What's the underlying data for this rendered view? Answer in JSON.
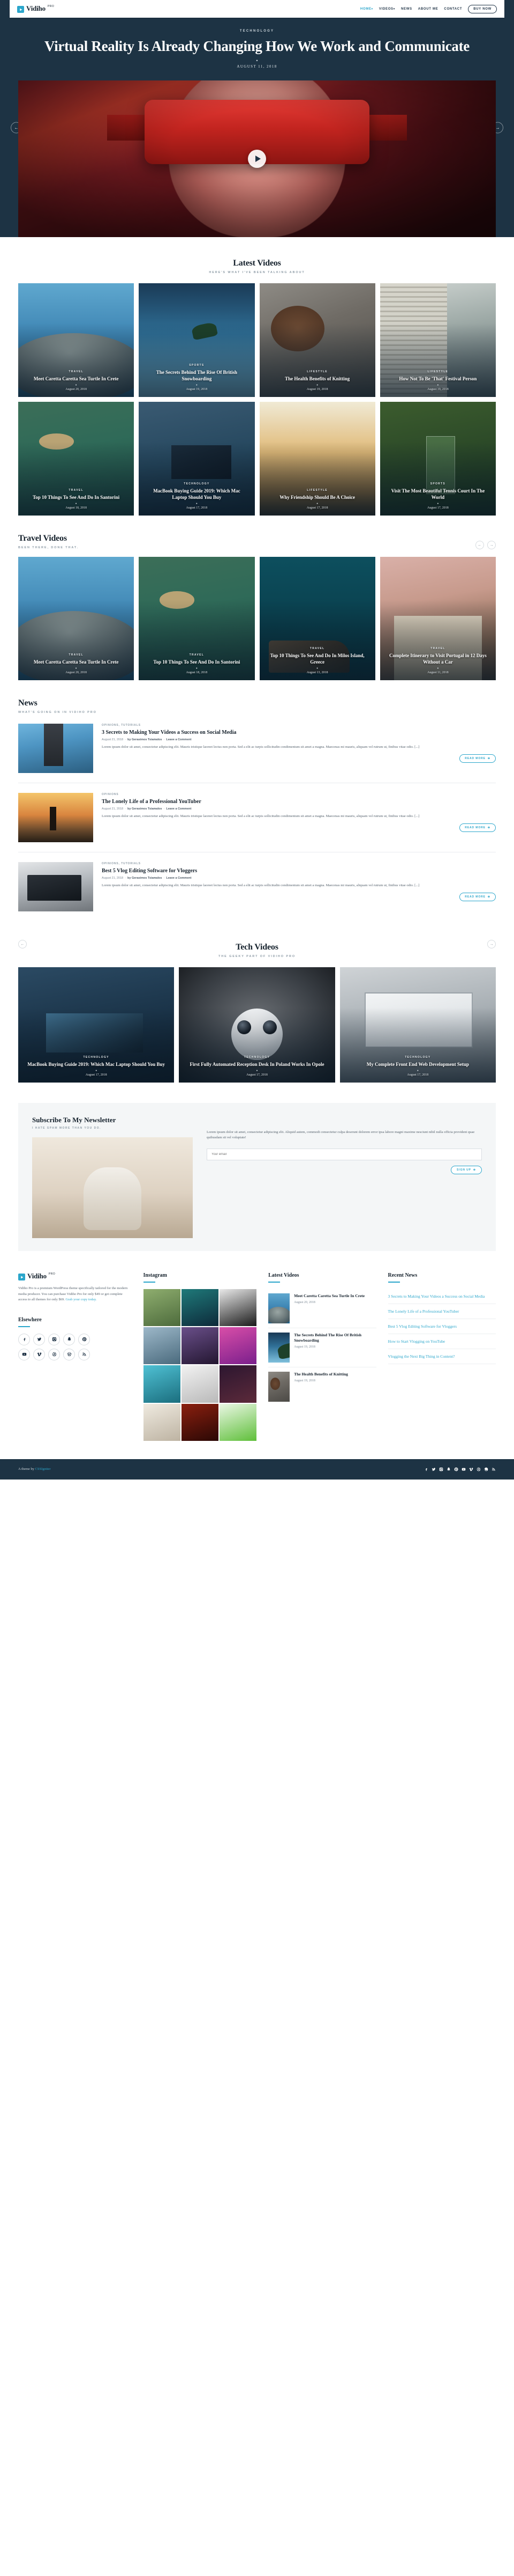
{
  "brand": {
    "name": "Vidiho",
    "sup": "PRO",
    "accent": "#2ba6cb",
    "dark": "#1d3344"
  },
  "nav": {
    "items": [
      {
        "label": "HOME",
        "caret": "▾",
        "active": true
      },
      {
        "label": "VIDEOS",
        "caret": "▾",
        "active": false
      },
      {
        "label": "NEWS",
        "caret": "",
        "active": false
      },
      {
        "label": "ABOUT ME",
        "caret": "",
        "active": false
      },
      {
        "label": "CONTACT",
        "caret": "",
        "active": false
      }
    ],
    "cta": "BUY NOW"
  },
  "hero": {
    "category": "TECHNOLOGY",
    "title": "Virtual Reality Is Already Changing How We Work and Communicate",
    "separator": "•",
    "date": "AUGUST 11, 2018",
    "prev": "←",
    "next": "→",
    "play": "play-button"
  },
  "latest": {
    "title": "Latest Videos",
    "subtitle": "HERE'S WHAT I'VE BEEN TALKING ABOUT",
    "cards": [
      {
        "cat": "TRAVEL",
        "title": "Meet Caretta Caretta Sea Turtle In Crete",
        "date": "August 20, 2018",
        "img": "img-turtle"
      },
      {
        "cat": "SPORTS",
        "title": "The Secrets Behind The Rise Of British Snowboarding",
        "date": "August 19, 2018",
        "img": "img-snow"
      },
      {
        "cat": "LIFESTYLE",
        "title": "The Health Benefits of Knitting",
        "date": "August 19, 2018",
        "img": "img-knit"
      },
      {
        "cat": "LIFESTYLE",
        "title": "How Not To Be 'That' Festival Person",
        "date": "August 19, 2018",
        "img": "img-city"
      },
      {
        "cat": "TRAVEL",
        "title": "Top 10 Things To See And Do In Santorini",
        "date": "August 18, 2018",
        "img": "img-santorini"
      },
      {
        "cat": "TECHNOLOGY",
        "title": "MacBook Buying Guide 2019: Which Mac Laptop Should You Buy",
        "date": "August 17, 2018",
        "img": "img-macbook"
      },
      {
        "cat": "LIFESTYLE",
        "title": "Why Friendship Should Be A Choice",
        "date": "August 17, 2018",
        "img": "img-friends"
      },
      {
        "cat": "SPORTS",
        "title": "Visit The Most Beautiful Tennis Court In The World",
        "date": "August 17, 2018",
        "img": "img-tennis"
      }
    ]
  },
  "travel": {
    "title": "Travel Videos",
    "subtitle": "BEEN THERE, DONE THAT.",
    "prev": "←",
    "next": "→",
    "cards": [
      {
        "cat": "TRAVEL",
        "title": "Meet Caretta Caretta Sea Turtle In Crete",
        "date": "August 20, 2018",
        "img": "img-turtle"
      },
      {
        "cat": "TRAVEL",
        "title": "Top 10 Things To See And Do In Santorini",
        "date": "August 18, 2018",
        "img": "img-santorini"
      },
      {
        "cat": "TRAVEL",
        "title": "Top 10 Things To See And Do In Milos Island, Greece",
        "date": "August 13, 2018",
        "img": "img-milos"
      },
      {
        "cat": "TRAVEL",
        "title": "Complete Itinerary to Visit Portugal in 12 Days Without a Car",
        "date": "August 11, 2018",
        "img": "img-portugal"
      }
    ]
  },
  "news": {
    "title": "News",
    "subtitle": "WHAT'S GOING ON IN VIDIHO PRO",
    "readmore": "READ MORE",
    "items": [
      {
        "cat": "OPINIONS, TUTORIALS",
        "title": "3 Secrets to Making Your Videos a Success on Social Media",
        "date": "August 21, 2018",
        "by": "by Gerasimos Tsiamalos",
        "comment": "Leave a Comment",
        "excerpt": "Lorem ipsum dolor sit amet, consectetur adipiscing elit. Mauris tristique laoreet lectus non porta. Sed a elit ac turpis sollicitudin condimentum sit amet a magna. Maecenas mi mauris, aliquam vel rutrum ut, finibus vitae odio. [...]",
        "img": "nt-1"
      },
      {
        "cat": "OPINIONS",
        "title": "The Lonely Life of a Professional YouTuber",
        "date": "August 21, 2018",
        "by": "by Gerasimos Tsiamalos",
        "comment": "Leave a Comment",
        "excerpt": "Lorem ipsum dolor sit amet, consectetur adipiscing elit. Mauris tristique laoreet lectus non porta. Sed a elit ac turpis sollicitudin condimentum sit amet a magna. Maecenas mi mauris, aliquam vel rutrum ut, finibus vitae odio. [...]",
        "img": "nt-2"
      },
      {
        "cat": "OPINIONS, TUTORIALS",
        "title": "Best 5 Vlog Editing Software for Vloggers",
        "date": "August 21, 2018",
        "by": "by Gerasimos Tsiamalos",
        "comment": "Leave a Comment",
        "excerpt": "Lorem ipsum dolor sit amet, consectetur adipiscing elit. Mauris tristique laoreet lectus non porta. Sed a elit ac turpis sollicitudin condimentum sit amet a magna. Maecenas mi mauris, aliquam vel rutrum ut, finibus vitae odio. [...]",
        "img": "nt-3"
      }
    ]
  },
  "tech": {
    "title": "Tech Videos",
    "subtitle": "THE GEEKY PART OF VIDIHO PRO",
    "prev": "←",
    "next": "→",
    "cards": [
      {
        "cat": "TECHNOLOGY",
        "title": "MacBook Buying Guide 2019: Which Mac Laptop Should You Buy",
        "date": "August 17, 2018",
        "img": "img-laptopnight"
      },
      {
        "cat": "TECHNOLOGY",
        "title": "First Fully Automated Reception Desk In Poland Works In Opole",
        "date": "August 17, 2018",
        "img": "img-robot"
      },
      {
        "cat": "TECHNOLOGY",
        "title": "My Complete Front End Web Development Setup",
        "date": "August 17, 2018",
        "img": "img-desk"
      }
    ]
  },
  "newsletter": {
    "title": "Subscribe To My Newsletter",
    "subtitle": "I HATE SPAM MORE THAN YOU DO.",
    "copy": "Lorem ipsum dolor sit amet, consectetur adipiscing elit. Aliquid autem, commodi consectetur culpa deserunt dolorem error ipsa labore magni maxime nesciunt nihil nulla officia provident quae quibusdam sit vel voluptate!",
    "placeholder": "Your email",
    "button": "SIGN UP"
  },
  "footer": {
    "about": {
      "logo": "Vidiho",
      "sup": "PRO",
      "text": "Vidiho Pro is a premium WordPress theme specifically tailored for the modern media producer. You can purchase Vidiho Pro for only $49 or get complete access to all themes for only $69. ",
      "link": "Grab your copy today."
    },
    "elsewhere": {
      "title": "Elsewhere",
      "icons": [
        "facebook-icon",
        "twitter-icon",
        "instagram-icon",
        "snapchat-icon",
        "pinterest-icon",
        "youtube-icon",
        "vimeo-icon",
        "dribbble-icon",
        "wordpress-icon",
        "rss-icon"
      ]
    },
    "instagram": {
      "title": "Instagram"
    },
    "latest": {
      "title": "Latest Videos",
      "items": [
        {
          "title": "Meet Caretta Caretta Sea Turtle In Crete",
          "date": "August 20, 2018",
          "img": "img-turtle"
        },
        {
          "title": "The Secrets Behind The Rise Of British Snowboarding",
          "date": "August 19, 2018",
          "img": "img-snow"
        },
        {
          "title": "The Health Benefits of Knitting",
          "date": "August 19, 2018",
          "img": "img-knit"
        }
      ]
    },
    "recent": {
      "title": "Recent News",
      "items": [
        "3 Secrets to Making Your Videos a Success on Social Media",
        "The Lonely Life of a Professional YouTuber",
        "Best 5 Vlog Editing Software for Vloggers",
        "How to Start Vlogging on YouTube",
        "Vlogging the Next Big Thing in Content?"
      ]
    },
    "bottom": {
      "prefix": "A theme by ",
      "link": "CSSIgniter"
    }
  }
}
